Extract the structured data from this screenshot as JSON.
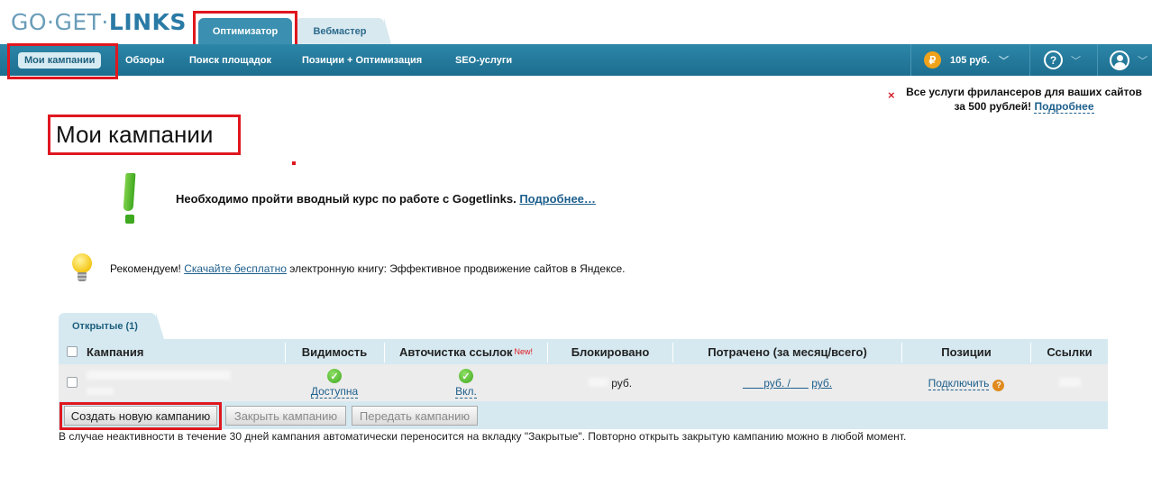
{
  "brand": {
    "logo_light": "GO·GET·",
    "logo_bold": "LINKS"
  },
  "role_tabs": [
    "Оптимизатор",
    "Вебмастер"
  ],
  "nav": {
    "items": [
      "Мои кампании",
      "Обзоры",
      "Поиск площадок",
      "Позиции + Оптимизация",
      "SEO-услуги"
    ],
    "balance": "105 руб.",
    "currency_symbol": "₽",
    "help_symbol": "?"
  },
  "promo": {
    "text": "Все услуги фрилансеров для ваших сайтов за 500 рублей!",
    "link": "Подробнее",
    "close": "×"
  },
  "page_title": "Мои кампании",
  "notice": {
    "text": "Необходимо пройти вводный курс по работе с Gogetlinks.",
    "link": "Подробнее…"
  },
  "recommend": {
    "prefix": "Рекомендуем!",
    "link": "Скачайте бесплатно",
    "suffix": "электронную книгу: Эффективное продвижение сайтов в Яндексе."
  },
  "section_tab": "Открытые (1)",
  "table": {
    "headers": {
      "campaign": "Кампания",
      "visibility": "Видимость",
      "autoclean": "Авточистка ссылок",
      "autoclean_badge": "New!",
      "blocked": "Блокировано",
      "spent": "Потрачено (за месяц/всего)",
      "positions": "Позиции",
      "links": "Ссылки"
    },
    "row": {
      "visibility": "Доступна",
      "autoclean": "Вкл.",
      "blocked_unit": "руб.",
      "spent_month_unit": "руб. /",
      "spent_total_unit": "руб.",
      "positions": "Подключить",
      "positions_help": "?"
    }
  },
  "buttons": {
    "create": "Создать новую кампанию",
    "close": "Закрыть кампанию",
    "transfer": "Передать кампанию"
  },
  "footnote": "В случае неактивности в течение 30 дней кампания автоматически переносится на вкладку \"Закрытые\". Повторно открыть закрытую кампанию можно в любой момент."
}
